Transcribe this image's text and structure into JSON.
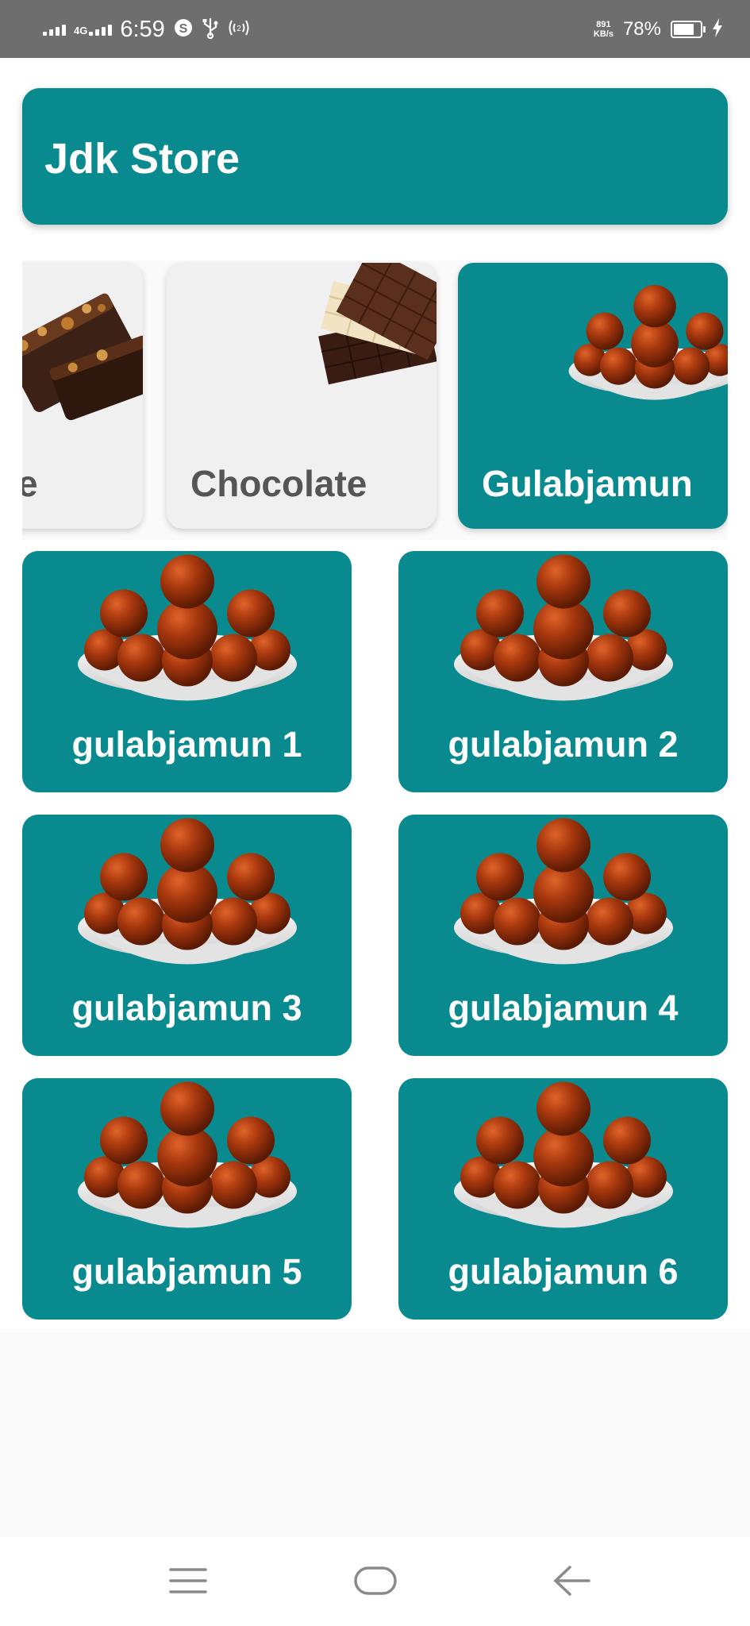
{
  "status_bar": {
    "network": "4G",
    "time": "6:59",
    "speed_value": "891",
    "speed_unit": "KB/s",
    "battery_percent": "78%",
    "battery_level": 0.78
  },
  "header": {
    "title": "Jdk Store"
  },
  "categories": [
    {
      "label": "e",
      "icon": "brownie-image",
      "selected": false
    },
    {
      "label": "Chocolate",
      "icon": "chocolate-image",
      "selected": false
    },
    {
      "label": "Gulabjamun",
      "icon": "gulabjamun-image",
      "selected": true
    }
  ],
  "products": [
    {
      "label": "gulabjamun 1",
      "icon": "gulabjamun-image"
    },
    {
      "label": "gulabjamun 2",
      "icon": "gulabjamun-image"
    },
    {
      "label": "gulabjamun 3",
      "icon": "gulabjamun-image"
    },
    {
      "label": "gulabjamun 4",
      "icon": "gulabjamun-image"
    },
    {
      "label": "gulabjamun 5",
      "icon": "gulabjamun-image"
    },
    {
      "label": "gulabjamun 6",
      "icon": "gulabjamun-image"
    }
  ],
  "colors": {
    "accent": "#088a8f",
    "card_light": "#f0f0f0",
    "status_bar": "#6e6e6e"
  },
  "nav": {
    "icons": [
      "menu-icon",
      "home-icon",
      "back-icon"
    ]
  }
}
